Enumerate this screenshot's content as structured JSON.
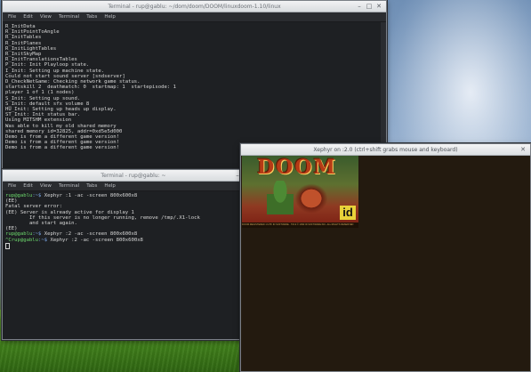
{
  "desktop": {
    "bg": "#8eaacb"
  },
  "window1": {
    "title": "Terminal - rup@gablu: ~/dom/doom/DOOM/linuxdoom-1.10/linux",
    "menu": [
      "File",
      "Edit",
      "View",
      "Terminal",
      "Tabs",
      "Help"
    ],
    "lines": [
      "R_InitData",
      "R_InitPointToAngle",
      "R_InitTables",
      "R_InitPlanes",
      "R_InitLightTables",
      "R_InitSkyMap",
      "R_InitTranslationsTables",
      "P_Init: Init Playloop state.",
      "I_Init: Setting up machine state.",
      "Could not start sound server [sndserver]",
      "D_CheckNetGame: Checking network game status.",
      "startskill 2  deathmatch: 0  startmap: 1  startepisode: 1",
      "player 1 of 1 (1 nodes)",
      "S_Init: Setting up sound.",
      "S_Init: default sfx volume 8",
      "HU_Init: Setting up heads up display.",
      "ST_Init: Init status bar.",
      "Using MITSHM extension",
      "Was able to kill my old shared memory",
      "shared memory id=32825, addr=0xd5e5d000",
      "Demo is from a different game version!",
      "Demo is from a different game version!",
      "Demo is from a different game version!"
    ]
  },
  "window2": {
    "title": "Terminal - rup@gablu: ~",
    "menu": [
      "File",
      "Edit",
      "View",
      "Terminal",
      "Tabs",
      "Help"
    ],
    "lines": [
      {
        "user": "rup@gablu",
        "path": ":~$",
        "cmd": " Xephyr :1 -ac -screen 800x600x8"
      },
      {
        "text": "(EE)"
      },
      {
        "text": "Fatal server error:"
      },
      {
        "text": "(EE) Server is already active for display 1"
      },
      {
        "text": "        If this server is no longer running, remove /tmp/.X1-lock"
      },
      {
        "text": "        and start again."
      },
      {
        "text": "(EE)"
      },
      {
        "user": "rup@gablu",
        "path": ":~$",
        "cmd": " Xephyr :2 -ac -screen 800x600x8"
      },
      {
        "user": "^Crup@gablu",
        "path": ":~$",
        "cmd": " Xephyr :2 -ac -screen 800x600x8"
      }
    ]
  },
  "window3": {
    "title": "Xephyr on :2.0 (ctrl+shift grabs mouse and keyboard)",
    "doom_title": "DOOM",
    "id_logo": "id",
    "footer": "DOOM REGISTERED 1.9 BY ID SOFTWARE  ·  TM & © 1993 ID SOFTWARE INC. ALL RIGHTS RESERVED"
  }
}
